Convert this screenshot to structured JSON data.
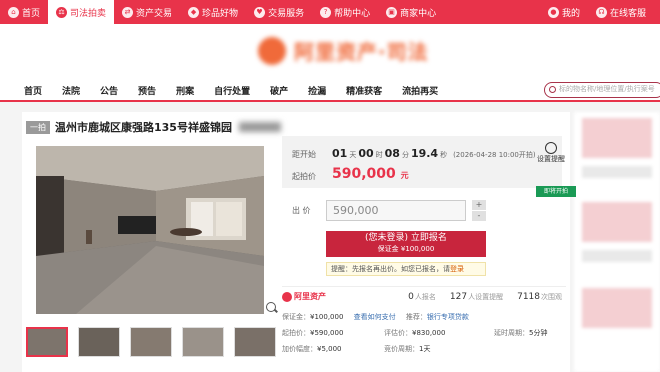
{
  "topbar": {
    "tabs": [
      {
        "label": "首页",
        "icon": "home-icon",
        "active": false
      },
      {
        "label": "司法拍卖",
        "icon": "gavel-icon",
        "active": true
      },
      {
        "label": "资产交易",
        "icon": "exchange-icon",
        "active": false
      },
      {
        "label": "珍品好物",
        "icon": "gem-icon",
        "active": false
      },
      {
        "label": "交易服务",
        "icon": "heart-icon",
        "active": false
      },
      {
        "label": "帮助中心",
        "icon": "help-icon",
        "active": false
      },
      {
        "label": "商家中心",
        "icon": "shop-icon",
        "active": false
      }
    ],
    "right": [
      {
        "label": "我的",
        "icon": "user-icon"
      },
      {
        "label": "在线客服",
        "icon": "headset-icon"
      }
    ]
  },
  "logo": {
    "text": "阿里资产·司法"
  },
  "nav": {
    "items": [
      "首页",
      "法院",
      "公告",
      "预告",
      "刑案",
      "自行处置",
      "破产",
      "捡漏",
      "精准获客",
      "流拍再买"
    ],
    "search_placeholder": "标的物名称/地理位置/执行案号"
  },
  "listing": {
    "tag": "一拍",
    "title": "温州市鹿城区康强路135号祥盛锦园",
    "countdown_label": "距开始",
    "countdown": {
      "days": "01",
      "days_unit": "天",
      "hours": "00",
      "hours_unit": "时",
      "minutes": "08",
      "minutes_unit": "分",
      "seconds": "19.4",
      "seconds_unit": "秒"
    },
    "countdown_time": "(2026-04-28 10:00开拍)",
    "start_price_label": "起拍价",
    "start_price": "590,000",
    "currency_unit": "元",
    "remind_label": "设置提醒",
    "bid_label": "出 价",
    "bid_value": "590,000",
    "plus": "+",
    "minus": "-",
    "signup_label": "(您未登录) 立即报名",
    "deposit_note": "保证金 ¥100,000",
    "tip_text": "提醒：先报名再出价。如您已报名，请",
    "tip_link": "登录",
    "status_tag": "即将开拍",
    "stats": {
      "brand": "阿里资产",
      "signups": "0",
      "signups_label": "人报名",
      "reminders": "127",
      "reminders_label": "人设置提醒",
      "views": "7118",
      "views_label": "次围观"
    },
    "details": {
      "deposit_label": "保证金：",
      "deposit_value": "¥100,000",
      "pay_link": "查看如何支付",
      "recommend_label": "推荐：",
      "recommend_link": "银行专项贷款",
      "start_label": "起拍价：",
      "start_value": "¥590,000",
      "appraise_label": "评估价：",
      "appraise_value": "¥830,000",
      "delay_label": "延时周期：",
      "delay_value": "5分钟",
      "increment_label": "加价幅度：",
      "increment_value": "¥5,000",
      "cycle_label": "竞价周期：",
      "cycle_value": "1天"
    }
  },
  "colors": {
    "brand": "#e8334a",
    "button": "#c8253d",
    "price": "#e8334a",
    "tag_green": "#1a9a55"
  }
}
